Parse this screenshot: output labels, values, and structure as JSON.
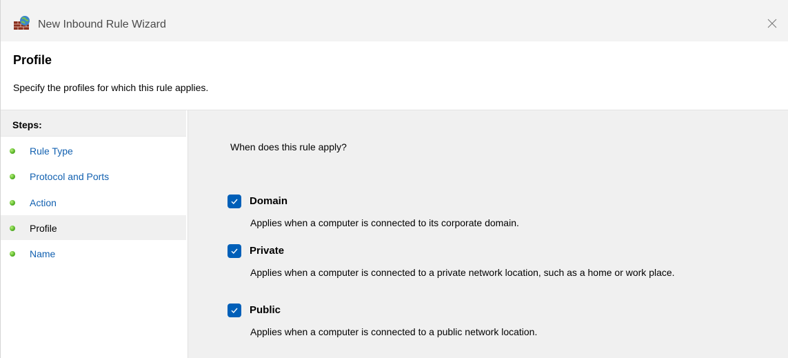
{
  "window": {
    "title": "New Inbound Rule Wizard",
    "icon": "firewall-icon",
    "close_icon": "close-icon"
  },
  "header": {
    "title": "Profile",
    "description": "Specify the profiles for which this rule applies."
  },
  "steps": {
    "heading": "Steps:",
    "items": [
      {
        "label": "Rule Type",
        "active": false
      },
      {
        "label": "Protocol and Ports",
        "active": false
      },
      {
        "label": "Action",
        "active": false
      },
      {
        "label": "Profile",
        "active": true
      },
      {
        "label": "Name",
        "active": false
      }
    ]
  },
  "main": {
    "question": "When does this rule apply?",
    "options": [
      {
        "label": "Domain",
        "checked": true,
        "description": "Applies when a computer is connected to its corporate domain."
      },
      {
        "label": "Private",
        "checked": true,
        "description": "Applies when a computer is connected to a private network location, such as a home or work place."
      },
      {
        "label": "Public",
        "checked": true,
        "description": "Applies when a computer is connected to a public network location."
      }
    ]
  },
  "colors": {
    "accent": "#005fb8",
    "link": "#1160b0",
    "panel_bg": "#f0f0f0",
    "step_dot": "#5cb82a"
  }
}
